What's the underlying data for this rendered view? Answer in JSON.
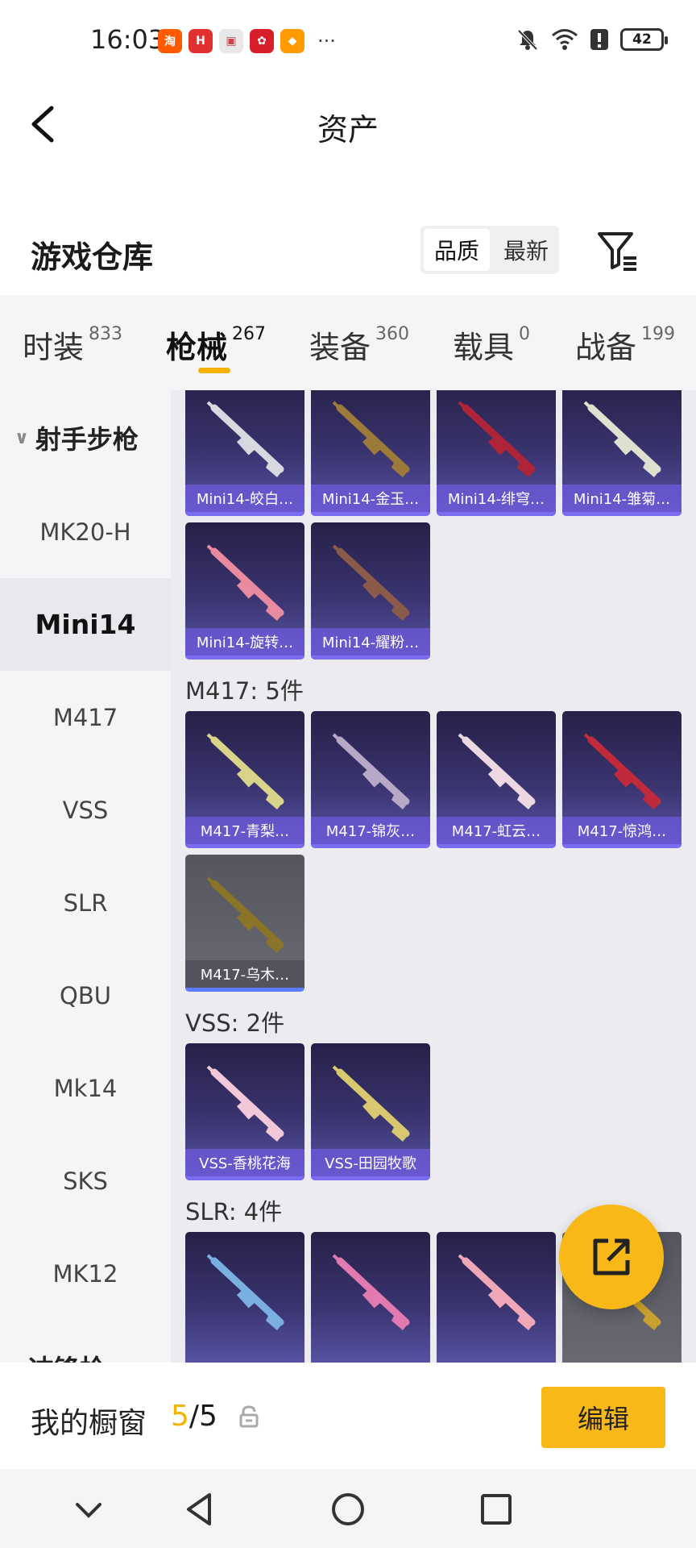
{
  "status_bar": {
    "time": "16:03",
    "battery": "42",
    "more": "···",
    "apps": [
      {
        "name": "taobao-app-icon",
        "glyph": "淘",
        "color": "#ff5a00"
      },
      {
        "name": "huawei-app-icon",
        "glyph": "H",
        "color": "#e03030"
      },
      {
        "name": "gift-app-icon",
        "glyph": "▣",
        "color": "#e8e8e8"
      },
      {
        "name": "red-app-icon",
        "glyph": "✿",
        "color": "#d81e2a"
      },
      {
        "name": "orange-app-icon",
        "glyph": "◆",
        "color": "#ff9a00"
      }
    ]
  },
  "header": {
    "title": "资产"
  },
  "warehouse": {
    "title": "游戏仓库",
    "sort_options": [
      "品质",
      "最新"
    ],
    "active_sort": "品质"
  },
  "tabs": [
    {
      "label": "时装",
      "count": "833"
    },
    {
      "label": "枪械",
      "count": "267"
    },
    {
      "label": "装备",
      "count": "360"
    },
    {
      "label": "载具",
      "count": "0"
    },
    {
      "label": "战备",
      "count": "199"
    }
  ],
  "sidebar": {
    "group": "射手步枪",
    "items": [
      "MK20-H",
      "Mini14",
      "M417",
      "VSS",
      "SLR",
      "QBU",
      "Mk14",
      "SKS",
      "MK12"
    ],
    "next_group": "冲锋枪"
  },
  "sections": [
    {
      "title": "",
      "cards": [
        {
          "label": "Mini14-皎白…",
          "tint": "#d8d8e0"
        },
        {
          "label": "Mini14-金玉…",
          "tint": "#9c7a3a"
        },
        {
          "label": "Mini14-绯穹…",
          "tint": "#b0243a"
        },
        {
          "label": "Mini14-雏菊…",
          "tint": "#e0e0d0"
        },
        {
          "label": "Mini14-旋转…",
          "tint": "#e88aa0"
        },
        {
          "label": "Mini14-耀粉…",
          "tint": "#8a5a4a"
        }
      ]
    },
    {
      "title": "M417: 5件",
      "cards": [
        {
          "label": "M417-青梨…",
          "tint": "#d8d48a"
        },
        {
          "label": "M417-锦灰…",
          "tint": "#b8a8c8"
        },
        {
          "label": "M417-虹云…",
          "tint": "#ecd8e0"
        },
        {
          "label": "M417-惊鸿…",
          "tint": "#c02a3a"
        },
        {
          "label": "M417-乌木…",
          "tint": "#8a7428"
        }
      ]
    },
    {
      "title": "VSS: 2件",
      "cards": [
        {
          "label": "VSS-香桃花海",
          "tint": "#f0c8d8"
        },
        {
          "label": "VSS-田园牧歌",
          "tint": "#d8c870"
        }
      ]
    },
    {
      "title": "SLR: 4件",
      "cards": [
        {
          "label": "",
          "tint": "#7ab0e0"
        },
        {
          "label": "",
          "tint": "#e07ab0"
        },
        {
          "label": "",
          "tint": "#f0a8b8"
        },
        {
          "label": "",
          "tint": "#c8a030"
        }
      ]
    }
  ],
  "showcase": {
    "title": "我的橱窗",
    "current": "5",
    "separator": "/",
    "total": "5",
    "edit_label": "编辑"
  },
  "colors": {
    "accent": "#f8b817",
    "card_bg": "#3a3470",
    "card_label": "#6e5adc"
  }
}
